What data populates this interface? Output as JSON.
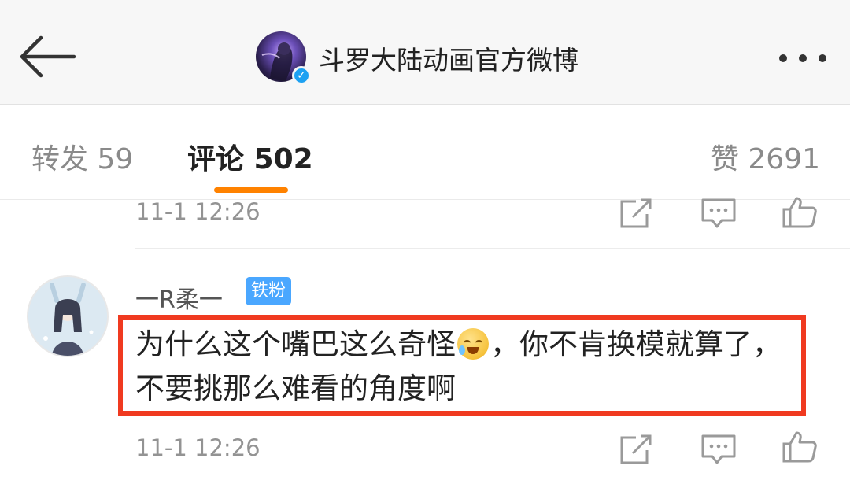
{
  "header": {
    "back_icon": "back-arrow-icon",
    "title": "斗罗大陆动画官方微博",
    "verified_icon": "verified-v-icon",
    "more_icon": "more-dots-icon"
  },
  "tabs": {
    "repost": "转发 59",
    "comment": "评论 502",
    "like": "赞 2691",
    "active": "comment",
    "accent_color": "#ff8200"
  },
  "prev_comment": {
    "time": "11-1 12:26",
    "actions": [
      "share-icon",
      "comment-icon",
      "like-icon"
    ]
  },
  "comment": {
    "user": "一R柔一",
    "badge": "铁粉",
    "badge_color": "#4aa7ff",
    "text_part1": "为什么这个嘴巴这么奇怪",
    "emoji": "crying-laugh-emoji",
    "text_part2": "，你不肯换模就算了，不要挑那么难看的角度啊",
    "time": "11-1 12:26",
    "actions": [
      "share-icon",
      "comment-icon",
      "like-icon"
    ],
    "highlight_color": "#f03a20"
  }
}
